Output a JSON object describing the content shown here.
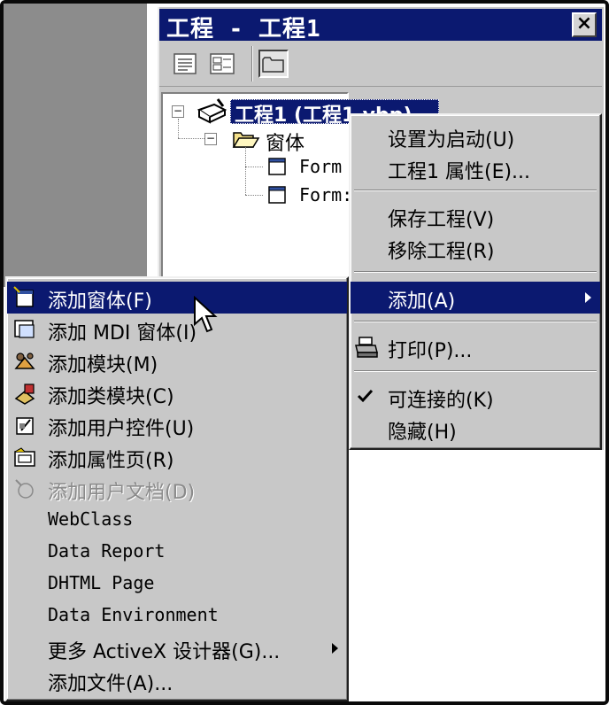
{
  "window": {
    "title": "工程 - 工程1",
    "close_label": "×"
  },
  "toolbar": {
    "buttons": [
      "view-code-icon",
      "view-object-icon",
      "toggle-folders-icon"
    ]
  },
  "tree": {
    "project_label": "工程1 (工程1.vbp)",
    "folder_label": "窗体",
    "forms": [
      "Form",
      "Form:"
    ]
  },
  "context_menu": {
    "items": [
      {
        "label": "设置为启动(U)"
      },
      {
        "label": "工程1 属性(E)..."
      },
      {
        "label": "保存工程(V)"
      },
      {
        "label": "移除工程(R)"
      },
      {
        "label": "添加(A)",
        "has_submenu": true,
        "highlighted": true
      },
      {
        "label": "打印(P)...",
        "icon": "printer-icon"
      },
      {
        "label": "可连接的(K)",
        "checked": true
      },
      {
        "label": "隐藏(H)"
      }
    ]
  },
  "add_submenu": {
    "items": [
      {
        "label": "添加窗体(F)",
        "icon": "form-icon",
        "highlighted": true
      },
      {
        "label": "添加 MDI 窗体(I)",
        "icon": "mdi-form-icon"
      },
      {
        "label": "添加模块(M)",
        "icon": "module-icon"
      },
      {
        "label": "添加类模块(C)",
        "icon": "class-module-icon"
      },
      {
        "label": "添加用户控件(U)",
        "icon": "user-control-icon"
      },
      {
        "label": "添加属性页(R)",
        "icon": "property-page-icon"
      },
      {
        "label": "添加用户文档(D)",
        "icon": "user-document-icon",
        "disabled": true
      },
      {
        "label": "WebClass"
      },
      {
        "label": "Data Report"
      },
      {
        "label": "DHTML Page"
      },
      {
        "label": "Data Environment"
      },
      {
        "label": "更多 ActiveX 设计器(G)...",
        "has_submenu": true
      },
      {
        "label": "添加文件(A)..."
      }
    ]
  },
  "colors": {
    "highlight": "#0b1970",
    "menu_bg": "#c8c8c8",
    "disabled_text": "#8a8a8a"
  }
}
